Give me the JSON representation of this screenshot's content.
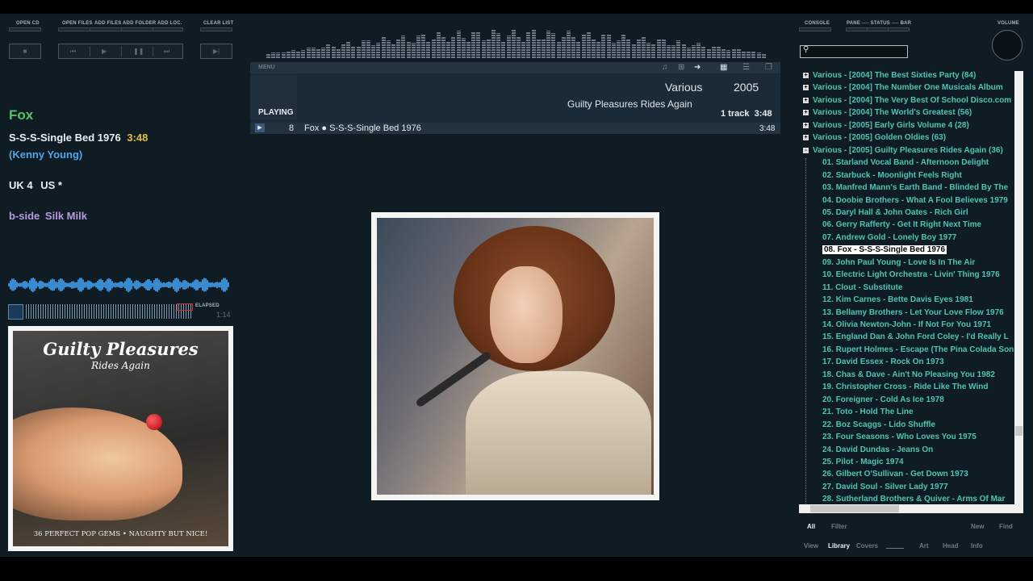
{
  "toolbar": {
    "open_cd": "OPEN CD",
    "open_files": "OPEN FILES",
    "add_files": "ADD FILES",
    "add_folder": "ADD FOLDER",
    "add_loc": "ADD LOC.",
    "clear_list": "CLEAR LIST",
    "console": "CONSOLE",
    "pane_status_bar": "PANE ── STATUS ── BAR",
    "volume": "VOLUME"
  },
  "now_playing": {
    "menu": "MENU",
    "playing_label": "PLAYING",
    "artist": "Various",
    "year": "2005",
    "album": "Guilty Pleasures Rides Again",
    "track_count": "1 track",
    "total_time": "3:48",
    "row_num": "8",
    "row_title": "Fox ● S-S-S-Single Bed 1976",
    "row_time": "3:48"
  },
  "info": {
    "artist": "Fox",
    "song": "S-S-S-Single Bed 1976",
    "time": "3:48",
    "writer": "(Kenny Young)",
    "chart_uk": "UK 4",
    "chart_us": "US *",
    "bside_label": "b-side",
    "bside_title": "Silk Milk"
  },
  "seek": {
    "elapsed_label": "ELAPSED",
    "elapsed_time": "1:14"
  },
  "album_art": {
    "title": "Guilty Pleasures",
    "subtitle": "Rides Again",
    "tagline": "36 PERFECT POP GEMS • NAUGHTY BUT NICE!"
  },
  "library": [
    {
      "text": "Various - [2004] The Best Sixties Party (84)",
      "level": 0,
      "expander": "+",
      "selected": false
    },
    {
      "text": "Various - [2004] The Number One Musicals Album",
      "level": 0,
      "expander": "+",
      "selected": false
    },
    {
      "text": "Various - [2004] The Very Best Of School Disco.com",
      "level": 0,
      "expander": "+",
      "selected": false
    },
    {
      "text": "Various - [2004] The World's Greatest (56)",
      "level": 0,
      "expander": "+",
      "selected": false
    },
    {
      "text": "Various - [2005] Early Girls Volume 4 (28)",
      "level": 0,
      "expander": "+",
      "selected": false
    },
    {
      "text": "Various - [2005] Golden Oldies (63)",
      "level": 0,
      "expander": "+",
      "selected": false
    },
    {
      "text": "Various - [2005] Guilty Pleasures Rides Again (36)",
      "level": 0,
      "expander": "-",
      "selected": false
    },
    {
      "text": "01. Starland Vocal Band - Afternoon Delight",
      "level": 1,
      "expander": "",
      "selected": false
    },
    {
      "text": "02. Starbuck - Moonlight Feels Right",
      "level": 1,
      "expander": "",
      "selected": false
    },
    {
      "text": "03. Manfred Mann's Earth Band - Blinded By The",
      "level": 1,
      "expander": "",
      "selected": false
    },
    {
      "text": "04. Doobie Brothers - What A Fool Believes 1979",
      "level": 1,
      "expander": "",
      "selected": false
    },
    {
      "text": "05. Daryl Hall & John Oates - Rich Girl",
      "level": 1,
      "expander": "",
      "selected": false
    },
    {
      "text": "06. Gerry Rafferty - Get It Right Next Time",
      "level": 1,
      "expander": "",
      "selected": false
    },
    {
      "text": "07. Andrew Gold - Lonely Boy 1977",
      "level": 1,
      "expander": "",
      "selected": false
    },
    {
      "text": "08. Fox - S-S-S-Single Bed 1976",
      "level": 1,
      "expander": "",
      "selected": true
    },
    {
      "text": "09. John Paul Young - Love Is In The Air",
      "level": 1,
      "expander": "",
      "selected": false
    },
    {
      "text": "10. Electric Light Orchestra - Livin' Thing 1976",
      "level": 1,
      "expander": "",
      "selected": false
    },
    {
      "text": "11. Clout - Substitute",
      "level": 1,
      "expander": "",
      "selected": false
    },
    {
      "text": "12. Kim Carnes - Bette Davis Eyes 1981",
      "level": 1,
      "expander": "",
      "selected": false
    },
    {
      "text": "13. Bellamy Brothers - Let Your Love Flow 1976",
      "level": 1,
      "expander": "",
      "selected": false
    },
    {
      "text": "14. Olivia Newton-John - If Not For You 1971",
      "level": 1,
      "expander": "",
      "selected": false
    },
    {
      "text": "15. England Dan & John Ford Coley - I'd Really L",
      "level": 1,
      "expander": "",
      "selected": false
    },
    {
      "text": "16. Rupert Holmes - Escape (The Pina Colada Son",
      "level": 1,
      "expander": "",
      "selected": false
    },
    {
      "text": "17. David Essex - Rock On 1973",
      "level": 1,
      "expander": "",
      "selected": false
    },
    {
      "text": "18. Chas & Dave - Ain't No Pleasing You 1982",
      "level": 1,
      "expander": "",
      "selected": false
    },
    {
      "text": "19. Christopher Cross - Ride Like The Wind",
      "level": 1,
      "expander": "",
      "selected": false
    },
    {
      "text": "20. Foreigner - Cold As Ice 1978",
      "level": 1,
      "expander": "",
      "selected": false
    },
    {
      "text": "21. Toto - Hold The Line",
      "level": 1,
      "expander": "",
      "selected": false
    },
    {
      "text": "22. Boz Scaggs - Lido Shuffle",
      "level": 1,
      "expander": "",
      "selected": false
    },
    {
      "text": "23. Four Seasons - Who Loves You 1975",
      "level": 1,
      "expander": "",
      "selected": false
    },
    {
      "text": "24. David Dundas - Jeans On",
      "level": 1,
      "expander": "",
      "selected": false
    },
    {
      "text": "25. Pilot - Magic 1974",
      "level": 1,
      "expander": "",
      "selected": false
    },
    {
      "text": "26. Gilbert O'Sullivan - Get Down 1973",
      "level": 1,
      "expander": "",
      "selected": false
    },
    {
      "text": "27. David Soul - Silver Lady 1977",
      "level": 1,
      "expander": "",
      "selected": false
    },
    {
      "text": "28. Sutherland Brothers & Quiver - Arms Of Mar",
      "level": 1,
      "expander": "",
      "selected": false
    }
  ],
  "bottom": {
    "all": "All",
    "filter": "Filter",
    "new": "New",
    "find": "Find",
    "view": "View",
    "library": "Library",
    "covers": "Covers",
    "art": "Art",
    "head": "Head",
    "info": "Info"
  },
  "colors": {
    "accent_green": "#4fc46a",
    "accent_teal": "#4fc4b0",
    "time_yellow": "#e0c040",
    "writer_blue": "#4fa6e8",
    "bside_purple": "#b89ae0"
  }
}
